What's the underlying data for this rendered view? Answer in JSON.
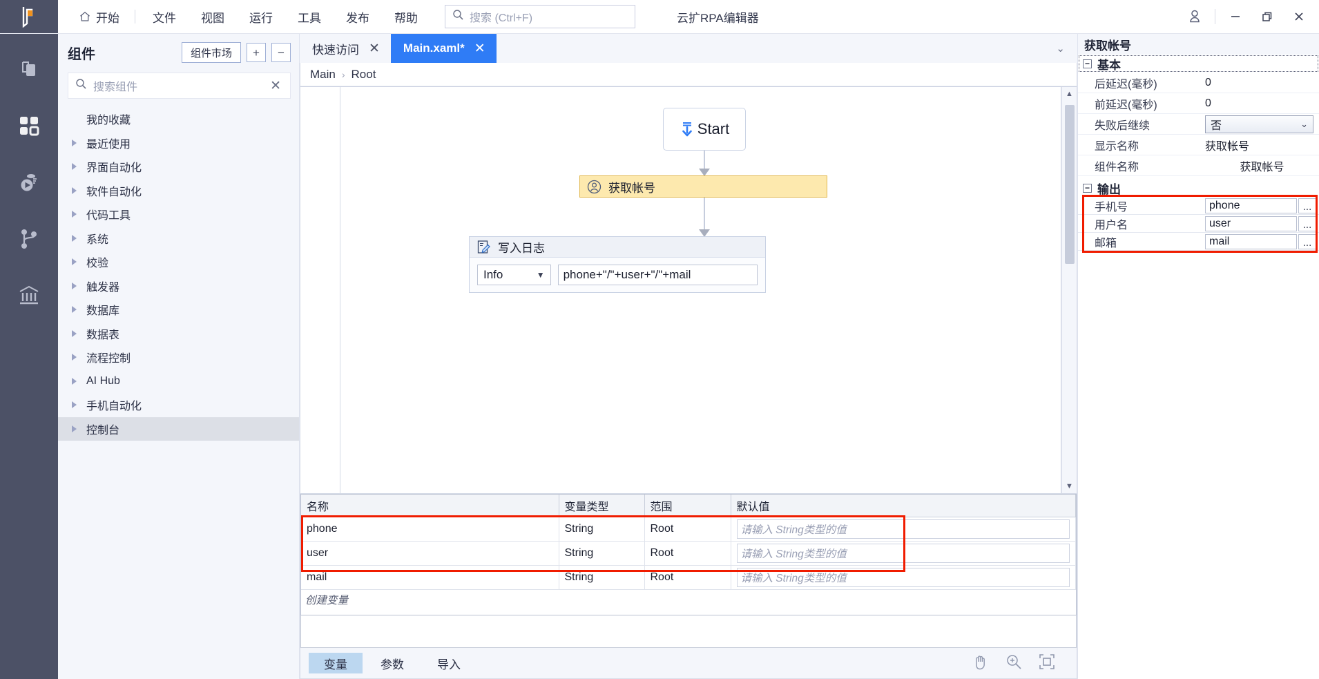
{
  "topbar": {
    "home_label": "开始",
    "menu": [
      "文件",
      "视图",
      "运行",
      "工具",
      "发布",
      "帮助"
    ],
    "search_placeholder": "搜索 (Ctrl+F)",
    "search_value": "",
    "app_title": "云扩RPA编辑器",
    "account_icon": "user-icon",
    "minimize_icon": "minimize-icon",
    "restore_icon": "restore-icon",
    "close_icon": "close-icon"
  },
  "rail": {
    "items": [
      {
        "icon": "copy-pages-icon",
        "name": "projects"
      },
      {
        "icon": "grid-squares-icon",
        "name": "components"
      },
      {
        "icon": "run-debug-icon",
        "name": "run"
      },
      {
        "icon": "git-branch-icon",
        "name": "version-control"
      },
      {
        "icon": "bank-icon",
        "name": "assets"
      }
    ]
  },
  "components": {
    "title": "组件",
    "market_button": "组件市场",
    "expand_all": "+",
    "collapse_all": "−",
    "search_placeholder": "搜索组件",
    "search_value": "",
    "clear_icon": "close-icon",
    "items": [
      {
        "label": "我的收藏",
        "has_arrow": false,
        "selected": false
      },
      {
        "label": "最近使用",
        "has_arrow": true,
        "selected": false
      },
      {
        "label": "界面自动化",
        "has_arrow": true,
        "selected": false
      },
      {
        "label": "软件自动化",
        "has_arrow": true,
        "selected": false
      },
      {
        "label": "代码工具",
        "has_arrow": true,
        "selected": false
      },
      {
        "label": "系统",
        "has_arrow": true,
        "selected": false
      },
      {
        "label": "校验",
        "has_arrow": true,
        "selected": false
      },
      {
        "label": "触发器",
        "has_arrow": true,
        "selected": false
      },
      {
        "label": "数据库",
        "has_arrow": true,
        "selected": false
      },
      {
        "label": "数据表",
        "has_arrow": true,
        "selected": false
      },
      {
        "label": "流程控制",
        "has_arrow": true,
        "selected": false
      },
      {
        "label": "AI Hub",
        "has_arrow": true,
        "selected": false
      },
      {
        "label": "手机自动化",
        "has_arrow": true,
        "selected": false
      },
      {
        "label": "控制台",
        "has_arrow": true,
        "selected": true
      }
    ]
  },
  "tabs": {
    "items": [
      {
        "label": "快速访问",
        "active": false,
        "close_icon": "close-icon"
      },
      {
        "label": "Main.xaml*",
        "active": true,
        "close_icon": "close-icon"
      }
    ],
    "collapse_icon": "chevron-down-icon"
  },
  "breadcrumb": {
    "parts": [
      "Main",
      "Root"
    ],
    "separator": "›"
  },
  "canvas": {
    "start_node": {
      "label": "Start",
      "icon": "start-download-icon"
    },
    "activity_node": {
      "label": "获取帐号",
      "icon": "user-circle-icon"
    },
    "log_node": {
      "title": "写入日志",
      "icon": "write-log-icon",
      "level": "Info",
      "level_caret": "▼",
      "message": "phone+\"/\"+user+\"/\"+mail"
    },
    "scroll_up_icon": "chevron-up-icon",
    "scroll_down_icon": "chevron-down-icon"
  },
  "variables": {
    "headers": [
      "名称",
      "变量类型",
      "范围",
      "默认值"
    ],
    "rows": [
      {
        "name": "phone",
        "type": "String",
        "scope": "Root",
        "default_placeholder": "请输入 String类型的值"
      },
      {
        "name": "user",
        "type": "String",
        "scope": "Root",
        "default_placeholder": "请输入 String类型的值"
      },
      {
        "name": "mail",
        "type": "String",
        "scope": "Root",
        "default_placeholder": "请输入 String类型的值"
      }
    ],
    "create_row_placeholder": "创建变量",
    "tabs": [
      {
        "label": "变量",
        "active": true
      },
      {
        "label": "参数",
        "active": false
      },
      {
        "label": "导入",
        "active": false
      }
    ],
    "tools": [
      {
        "icon": "pan-hand-icon"
      },
      {
        "icon": "zoom-in-icon"
      },
      {
        "icon": "fit-to-screen-icon"
      }
    ],
    "highlight_color": "#f01c00"
  },
  "properties": {
    "title": "获取帐号",
    "basic": {
      "group_label": "基本",
      "collapse_icon": "minus-box-icon",
      "rows": [
        {
          "key": "后延迟(毫秒)",
          "value": "0",
          "type": "text"
        },
        {
          "key": "前延迟(毫秒)",
          "value": "0",
          "type": "text"
        },
        {
          "key": "失败后继续",
          "value": "否",
          "type": "select",
          "caret": "⌄"
        },
        {
          "key": "显示名称",
          "value": "获取帐号",
          "type": "text"
        },
        {
          "key": "组件名称",
          "value": "获取帐号",
          "type": "text"
        }
      ]
    },
    "output": {
      "group_label": "输出",
      "collapse_icon": "minus-box-icon",
      "rows": [
        {
          "key": "手机号",
          "value": "phone",
          "more": "..."
        },
        {
          "key": "用户名",
          "value": "user",
          "more": "..."
        },
        {
          "key": "邮箱",
          "value": "mail",
          "more": "..."
        }
      ],
      "highlight_color": "#f01c00"
    }
  }
}
